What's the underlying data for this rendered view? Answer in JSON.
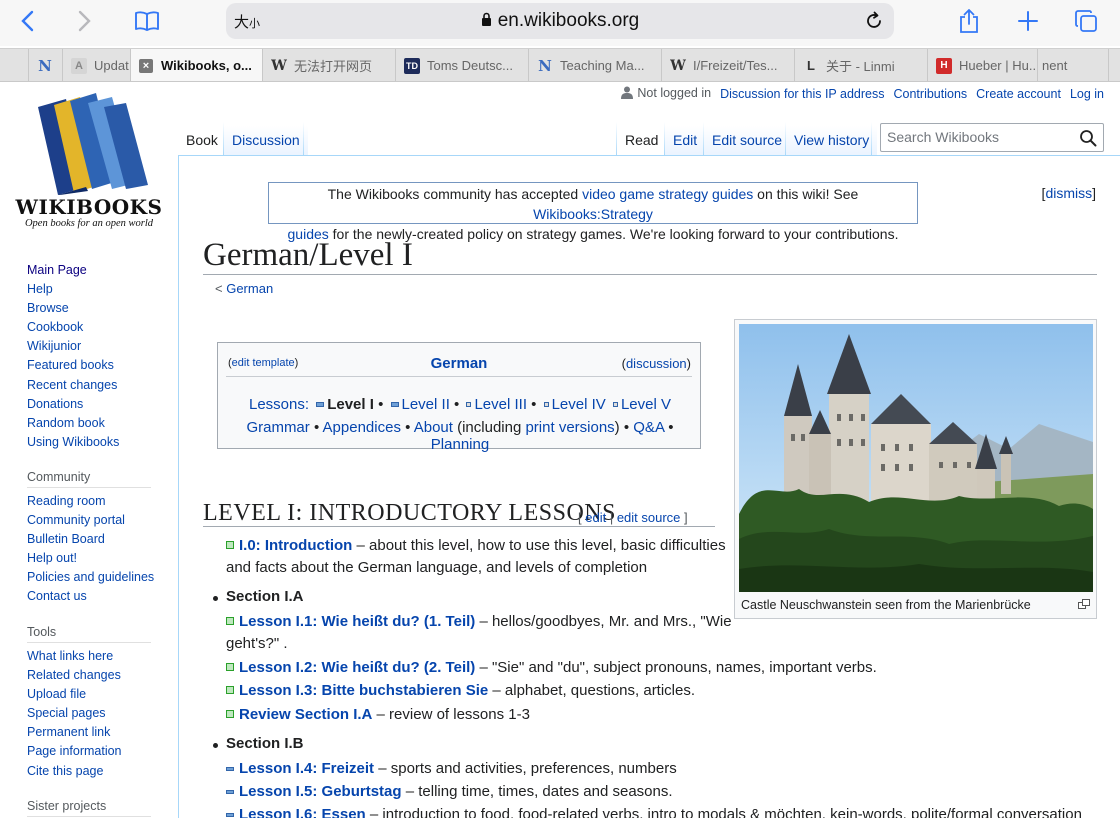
{
  "browser": {
    "text_size_label_big": "大",
    "text_size_label_small": "小",
    "url": "en.wikibooks.org",
    "icons": [
      "back-icon",
      "forward-icon",
      "bookmarks-icon",
      "lock-icon",
      "reload-icon",
      "share-icon",
      "new-tab-icon",
      "tabs-overview-icon"
    ]
  },
  "tabs": [
    {
      "favicon": "N",
      "title": ""
    },
    {
      "favicon": "A",
      "title": "Updat"
    },
    {
      "favicon": "×",
      "title": "Wikibooks, o..."
    },
    {
      "favicon": "W",
      "title": "无法打开网页"
    },
    {
      "favicon": "TD",
      "title": "Toms Deutsc..."
    },
    {
      "favicon": "N",
      "title": "Teaching Ma..."
    },
    {
      "favicon": "W",
      "title": "I/Freizeit/Tes..."
    },
    {
      "favicon": "L",
      "title": "关于 - Linmi"
    },
    {
      "favicon": "H",
      "title": "Hueber | Hu..."
    },
    {
      "favicon": "",
      "title": "nent"
    }
  ],
  "personal": {
    "not_logged_in": "Not logged in",
    "discussion": "Discussion for this IP address",
    "contributions": "Contributions",
    "create_account": "Create account",
    "log_in": "Log in"
  },
  "namespaces": {
    "book": "Book",
    "discussion": "Discussion"
  },
  "views": {
    "read": "Read",
    "edit": "Edit",
    "edit_source": "Edit source",
    "history": "View history"
  },
  "search": {
    "placeholder": "Search Wikibooks"
  },
  "logo": {
    "name": "WIKIBOOKS",
    "tagline": "Open books for an open world"
  },
  "sidebar": {
    "main": [
      "Main Page",
      "Help",
      "Browse",
      "Cookbook",
      "Wikijunior",
      "Featured books",
      "Recent changes",
      "Donations",
      "Random book",
      "Using Wikibooks"
    ],
    "community_heading": "Community",
    "community": [
      "Reading room",
      "Community portal",
      "Bulletin Board",
      "Help out!",
      "Policies and guidelines",
      "Contact us"
    ],
    "tools_heading": "Tools",
    "tools": [
      "What links here",
      "Related changes",
      "Upload file",
      "Special pages",
      "Permanent link",
      "Page information",
      "Cite this page"
    ],
    "sister_heading": "Sister projects"
  },
  "notice": {
    "t1": "The Wikibooks community has accepted ",
    "l1": "video game strategy guides",
    "t2": " on this wiki! See ",
    "l2a": "Wikibooks:Strategy",
    "l2b": "guides",
    "t3": " for the newly-created policy on strategy games. We're looking forward to your contributions.",
    "dismiss": "dismiss"
  },
  "page": {
    "title": "German/Level I",
    "breadcrumb_prefix": "< ",
    "breadcrumb_link": "German"
  },
  "navbox": {
    "edit_template": "edit template",
    "title": "German",
    "discussion": "discussion",
    "lessons_label": "Lessons:",
    "levels": [
      "Level I",
      "Level II",
      "Level III",
      "Level IV",
      "Level V"
    ],
    "grammar": "Grammar",
    "appendices": "Appendices",
    "about": "About",
    "including": "(including ",
    "print_versions": "print versions",
    "close_paren": ")",
    "qa": "Q&A",
    "planning": "Planning"
  },
  "thumb": {
    "caption": "Castle Neuschwanstein seen from the Marienbrücke"
  },
  "section": {
    "heading": "LEVEL I: INTRODUCTORY LESSONS",
    "edit": "edit",
    "edit_source": "edit source",
    "intro_link": "I.0: Introduction",
    "intro_desc1": " – about this level, how to use this level, basic difficulties",
    "intro_desc2": "and facts about the German language, and levels of completion",
    "sub_a": "Section I.A",
    "sub_b": "Section I.B",
    "lessons_a": [
      {
        "link": "Lesson I.1: Wie heißt du? (1. Teil)",
        "desc": " – hellos/goodbyes, Mr. and Mrs., \"Wie",
        "desc2": "geht's?\" ."
      },
      {
        "link": "Lesson I.2: Wie heißt du? (2. Teil)",
        "desc": " – \"Sie\" and \"du\", subject pronouns, names, important verbs."
      },
      {
        "link": "Lesson I.3: Bitte buchstabieren Sie",
        "desc": " – alphabet, questions, articles."
      },
      {
        "link": "Review Section I.A",
        "desc": " – review of lessons 1-3"
      }
    ],
    "lessons_b": [
      {
        "link": "Lesson I.4: Freizeit",
        "desc": " – sports and activities, preferences, numbers"
      },
      {
        "link": "Lesson I.5: Geburtstag",
        "desc": " – telling time, times, dates and seasons."
      },
      {
        "link": "Lesson I.6: Essen",
        "desc": " – introduction to food, food-related verbs, intro to modals & möchten, kein-words, polite/formal conversation"
      }
    ]
  }
}
